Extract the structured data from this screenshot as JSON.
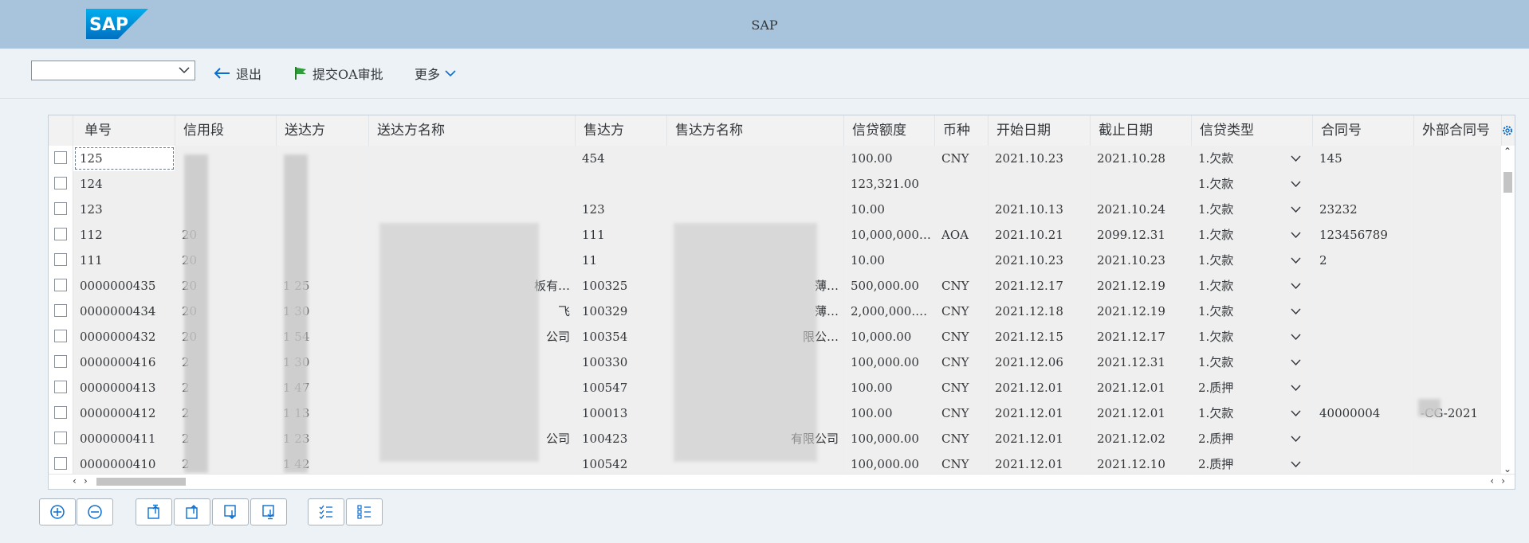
{
  "shell": {
    "title": "SAP",
    "logo_text": "SAP",
    "bar_color": "#a8c3dc"
  },
  "toolbar": {
    "dropdown_value": "",
    "exit_label": "退出",
    "submit_label": "提交OA审批",
    "more_label": "更多"
  },
  "table": {
    "columns": [
      "单号",
      "信用段",
      "送达方",
      "送达方名称",
      "售达方",
      "售达方名称",
      "信贷额度",
      "币种",
      "开始日期",
      "截止日期",
      "信贷类型",
      "合同号",
      "外部合同号"
    ],
    "rows": [
      {
        "id": "125",
        "seg": "",
        "ship": "",
        "shipname": "",
        "sold": "454",
        "soldname": "",
        "credit": "100.00",
        "cur": "CNY",
        "start": "2021.10.23",
        "end": "2021.10.28",
        "type": "1.欠款",
        "contract": "145",
        "ext": ""
      },
      {
        "id": "124",
        "seg": "",
        "ship": "",
        "shipname": "",
        "sold": "",
        "soldname": "",
        "credit": "123,321.00",
        "cur": "",
        "start": "",
        "end": "",
        "type": "1.欠款",
        "contract": "",
        "ext": ""
      },
      {
        "id": "123",
        "seg": "",
        "ship": "",
        "shipname": "",
        "sold": "123",
        "soldname": "",
        "credit": "10.00",
        "cur": "",
        "start": "2021.10.13",
        "end": "2021.10.24",
        "type": "1.欠款",
        "contract": "23232",
        "ext": ""
      },
      {
        "id": "112",
        "seg": "20",
        "ship": "",
        "shipname": "",
        "sold": "111",
        "soldname": "",
        "credit": "10,000,000…",
        "cur": "AOA",
        "start": "2021.10.21",
        "end": "2099.12.31",
        "type": "1.欠款",
        "contract": "123456789",
        "ext": ""
      },
      {
        "id": "111",
        "seg": "20",
        "ship": "",
        "shipname": "",
        "sold": "11",
        "soldname": "",
        "credit": "10.00",
        "cur": "",
        "start": "2021.10.23",
        "end": "2021.10.23",
        "type": "1.欠款",
        "contract": "2",
        "ext": ""
      },
      {
        "id": "0000000435",
        "seg": "20",
        "ship": "1  25",
        "shipname": "板有…",
        "sold": "100325",
        "soldname": "薄…",
        "credit": "500,000.00",
        "cur": "CNY",
        "start": "2021.12.17",
        "end": "2021.12.19",
        "type": "1.欠款",
        "contract": "",
        "ext": ""
      },
      {
        "id": "0000000434",
        "seg": "20",
        "ship": "1  30",
        "shipname": "飞",
        "sold": "100329",
        "soldname": "薄…",
        "credit": "2,000,000.…",
        "cur": "CNY",
        "start": "2021.12.18",
        "end": "2021.12.19",
        "type": "1.欠款",
        "contract": "",
        "ext": ""
      },
      {
        "id": "0000000432",
        "seg": "20",
        "ship": "1  54",
        "shipname": "公司",
        "sold": "100354",
        "soldname": "限公…",
        "credit": "10,000.00",
        "cur": "CNY",
        "start": "2021.12.15",
        "end": "2021.12.17",
        "type": "1.欠款",
        "contract": "",
        "ext": ""
      },
      {
        "id": "0000000416",
        "seg": "2",
        "ship": "1  30",
        "shipname": "",
        "sold": "100330",
        "soldname": "",
        "credit": "100,000.00",
        "cur": "CNY",
        "start": "2021.12.06",
        "end": "2021.12.31",
        "type": "1.欠款",
        "contract": "",
        "ext": ""
      },
      {
        "id": "0000000413",
        "seg": "2",
        "ship": "1  47",
        "shipname": "",
        "sold": "100547",
        "soldname": "",
        "credit": "100.00",
        "cur": "CNY",
        "start": "2021.12.01",
        "end": "2021.12.01",
        "type": "2.质押",
        "contract": "",
        "ext": ""
      },
      {
        "id": "0000000412",
        "seg": "2",
        "ship": "1  13",
        "shipname": "",
        "sold": "100013",
        "soldname": "",
        "credit": "100.00",
        "cur": "CNY",
        "start": "2021.12.01",
        "end": "2021.12.01",
        "type": "1.欠款",
        "contract": "40000004",
        "ext": "-CG-2021"
      },
      {
        "id": "0000000411",
        "seg": "2",
        "ship": "1  23",
        "shipname": "公司",
        "sold": "100423",
        "soldname": "有限公司",
        "credit": "100,000.00",
        "cur": "CNY",
        "start": "2021.12.01",
        "end": "2021.12.02",
        "type": "2.质押",
        "contract": "",
        "ext": ""
      },
      {
        "id": "0000000410",
        "seg": "2",
        "ship": "1  42",
        "shipname": "",
        "sold": "100542",
        "soldname": "",
        "credit": "100,000.00",
        "cur": "CNY",
        "start": "2021.12.01",
        "end": "2021.12.10",
        "type": "2.质押",
        "contract": "",
        "ext": ""
      }
    ]
  },
  "bottom_buttons": [
    "expand-icon",
    "collapse-icon",
    "move-top-icon",
    "move-up-icon",
    "move-down-icon",
    "move-bottom-icon",
    "select-all-icon",
    "deselect-all-icon"
  ]
}
